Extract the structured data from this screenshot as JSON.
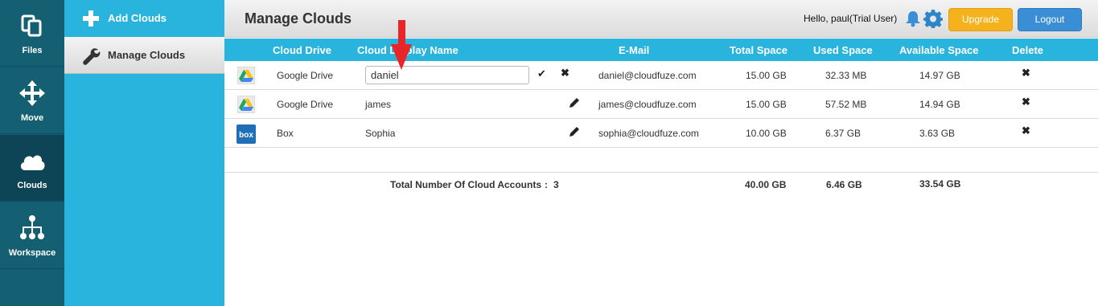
{
  "rail": [
    {
      "label": "Files",
      "icon": "files-icon"
    },
    {
      "label": "Move",
      "icon": "move-icon"
    },
    {
      "label": "Clouds",
      "icon": "cloud-icon"
    },
    {
      "label": "Workspace",
      "icon": "workspace-icon"
    }
  ],
  "subnav": {
    "add_clouds": "Add Clouds",
    "manage_clouds": "Manage Clouds"
  },
  "header": {
    "title": "Manage Clouds",
    "greeting": "Hello, paul(Trial User)",
    "upgrade": "Upgrade",
    "logout": "Logout"
  },
  "table": {
    "columns": [
      "Cloud Drive",
      "Cloud Display Name",
      "E-Mail",
      "Total Space",
      "Used Space",
      "Available Space",
      "Delete"
    ],
    "rows": [
      {
        "drive": "Google Drive",
        "name": "daniel",
        "email": "daniel@cloudfuze.com",
        "total": "15.00 GB",
        "used": "32.33 MB",
        "available": "14.97 GB",
        "icon": "google-drive-icon",
        "editing": true
      },
      {
        "drive": "Google Drive",
        "name": "james",
        "email": "james@cloudfuze.com",
        "total": "15.00 GB",
        "used": "57.52 MB",
        "available": "14.94 GB",
        "icon": "google-drive-icon",
        "editing": false
      },
      {
        "drive": "Box",
        "name": "Sophia",
        "email": "sophia@cloudfuze.com",
        "total": "10.00 GB",
        "used": "6.37 GB",
        "available": "3.63 GB",
        "icon": "box-icon",
        "editing": false
      }
    ],
    "totals": {
      "label": "Total Number Of Cloud Accounts",
      "separator": ":",
      "count": "3",
      "total": "40.00 GB",
      "used": "6.46 GB",
      "available": "33.54 GB"
    }
  },
  "colors": {
    "accent": "#28b4dc",
    "rail": "#155f72",
    "upgrade": "#f6b21d",
    "logout": "#3a8ed6",
    "annotation_arrow": "#e8262a"
  }
}
